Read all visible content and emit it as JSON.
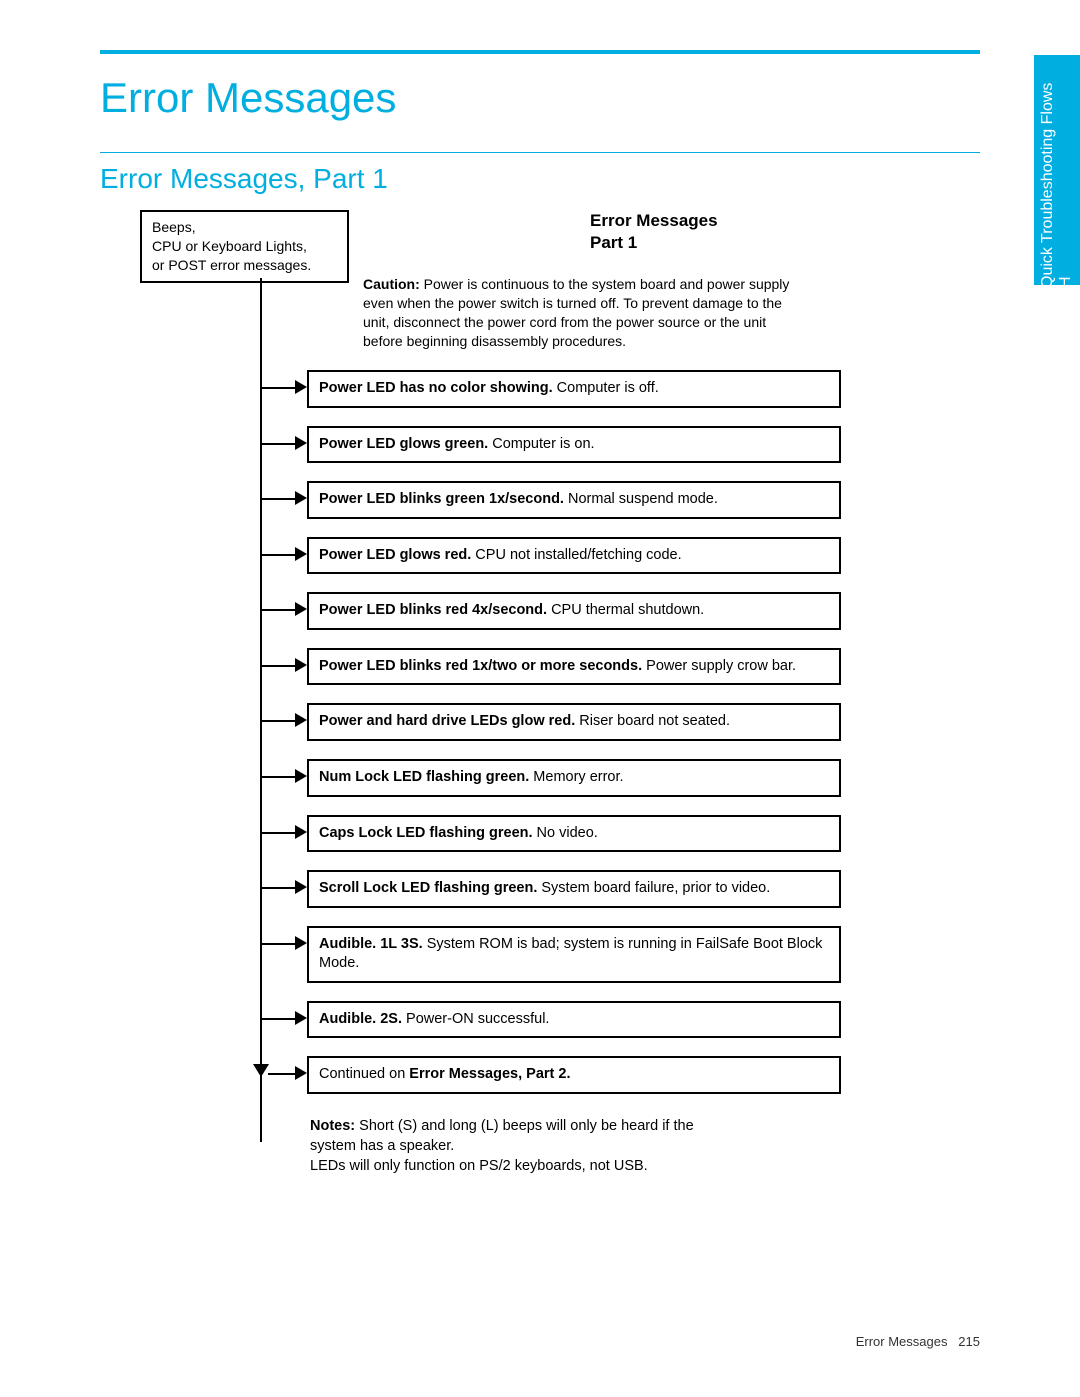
{
  "page": {
    "main_title": "Error Messages",
    "sub_title": "Error Messages, Part 1",
    "footer_label": "Error Messages",
    "footer_page": "215"
  },
  "side_tab": {
    "line1": "Quick Troubleshooting Flows",
    "line2": "H"
  },
  "diagram": {
    "title_line1": "Error Messages",
    "title_line2": "Part 1",
    "start_box_l1": "Beeps,",
    "start_box_l2": "CPU or Keyboard Lights,",
    "start_box_l3": "or POST error messages.",
    "caution_label": "Caution:",
    "caution_text": " Power is continuous to the system board and power supply even when the power switch is turned off. To prevent damage to the unit, disconnect the power cord from the power source or the unit before beginning disassembly procedures.",
    "rows": [
      {
        "bold": "Power LED has no color showing.",
        "rest": " Computer is off."
      },
      {
        "bold": "Power LED glows green.",
        "rest": " Computer is on."
      },
      {
        "bold": "Power LED blinks green 1x/second.",
        "rest": " Normal suspend mode."
      },
      {
        "bold": "Power LED glows red.",
        "rest": " CPU not installed/fetching code."
      },
      {
        "bold": "Power LED blinks red 4x/second.",
        "rest": " CPU thermal shutdown."
      },
      {
        "bold": "Power LED blinks red 1x/two or more seconds.",
        "rest": " Power supply crow bar."
      },
      {
        "bold": "Power and hard drive LEDs glow red.",
        "rest": "  Riser board not seated."
      },
      {
        "bold": "Num Lock LED flashing green.",
        "rest": " Memory error."
      },
      {
        "bold": "Caps Lock LED flashing green.",
        "rest": "  No video."
      },
      {
        "bold": "Scroll Lock LED flashing green.",
        "rest": " System board failure, prior to video."
      },
      {
        "bold": "Audible. 1L 3S.",
        "rest": " System ROM is bad; system is running in FailSafe Boot Block Mode."
      },
      {
        "bold": "Audible. 2S.",
        "rest": " Power-ON successful."
      }
    ],
    "continued_pre": "Continued on ",
    "continued_bold": "Error Messages, Part 2.",
    "notes_label": "Notes:",
    "notes_text1": " Short (S) and long (L) beeps will only be heard if the system has a speaker.",
    "notes_text2": "LEDs will only function on PS/2 keyboards, not USB."
  }
}
